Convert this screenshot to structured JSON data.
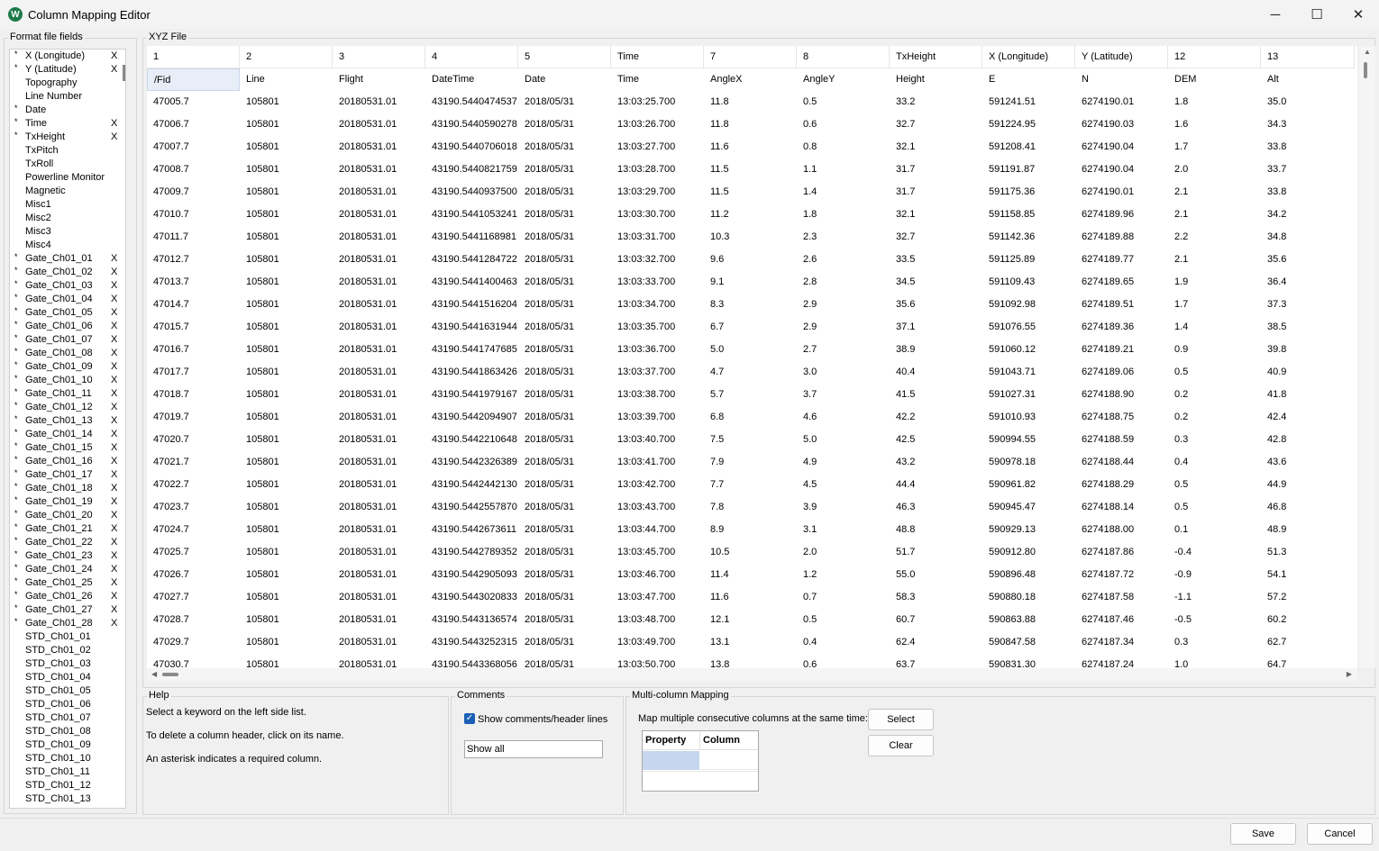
{
  "window": {
    "title": "Column Mapping Editor",
    "minimize": "─",
    "maximize": "☐",
    "close": "✕"
  },
  "fields_panel": {
    "label": "Format file fields",
    "items": [
      {
        "name": "X (Longitude)",
        "required": true,
        "mapped": true
      },
      {
        "name": "Y (Latitude)",
        "required": true,
        "mapped": true
      },
      {
        "name": "Topography",
        "required": false,
        "mapped": false
      },
      {
        "name": "Line Number",
        "required": false,
        "mapped": false
      },
      {
        "name": "Date",
        "required": true,
        "mapped": false
      },
      {
        "name": "Time",
        "required": true,
        "mapped": true
      },
      {
        "name": "TxHeight",
        "required": true,
        "mapped": true
      },
      {
        "name": "TxPitch",
        "required": false,
        "mapped": false
      },
      {
        "name": "TxRoll",
        "required": false,
        "mapped": false
      },
      {
        "name": "Powerline Monitor",
        "required": false,
        "mapped": false
      },
      {
        "name": "Magnetic",
        "required": false,
        "mapped": false
      },
      {
        "name": "Misc1",
        "required": false,
        "mapped": false
      },
      {
        "name": "Misc2",
        "required": false,
        "mapped": false
      },
      {
        "name": "Misc3",
        "required": false,
        "mapped": false
      },
      {
        "name": "Misc4",
        "required": false,
        "mapped": false
      },
      {
        "name": "Gate_Ch01_01",
        "required": true,
        "mapped": true
      },
      {
        "name": "Gate_Ch01_02",
        "required": true,
        "mapped": true
      },
      {
        "name": "Gate_Ch01_03",
        "required": true,
        "mapped": true
      },
      {
        "name": "Gate_Ch01_04",
        "required": true,
        "mapped": true
      },
      {
        "name": "Gate_Ch01_05",
        "required": true,
        "mapped": true
      },
      {
        "name": "Gate_Ch01_06",
        "required": true,
        "mapped": true
      },
      {
        "name": "Gate_Ch01_07",
        "required": true,
        "mapped": true
      },
      {
        "name": "Gate_Ch01_08",
        "required": true,
        "mapped": true
      },
      {
        "name": "Gate_Ch01_09",
        "required": true,
        "mapped": true
      },
      {
        "name": "Gate_Ch01_10",
        "required": true,
        "mapped": true
      },
      {
        "name": "Gate_Ch01_11",
        "required": true,
        "mapped": true
      },
      {
        "name": "Gate_Ch01_12",
        "required": true,
        "mapped": true
      },
      {
        "name": "Gate_Ch01_13",
        "required": true,
        "mapped": true
      },
      {
        "name": "Gate_Ch01_14",
        "required": true,
        "mapped": true
      },
      {
        "name": "Gate_Ch01_15",
        "required": true,
        "mapped": true
      },
      {
        "name": "Gate_Ch01_16",
        "required": true,
        "mapped": true
      },
      {
        "name": "Gate_Ch01_17",
        "required": true,
        "mapped": true
      },
      {
        "name": "Gate_Ch01_18",
        "required": true,
        "mapped": true
      },
      {
        "name": "Gate_Ch01_19",
        "required": true,
        "mapped": true
      },
      {
        "name": "Gate_Ch01_20",
        "required": true,
        "mapped": true
      },
      {
        "name": "Gate_Ch01_21",
        "required": true,
        "mapped": true
      },
      {
        "name": "Gate_Ch01_22",
        "required": true,
        "mapped": true
      },
      {
        "name": "Gate_Ch01_23",
        "required": true,
        "mapped": true
      },
      {
        "name": "Gate_Ch01_24",
        "required": true,
        "mapped": true
      },
      {
        "name": "Gate_Ch01_25",
        "required": true,
        "mapped": true
      },
      {
        "name": "Gate_Ch01_26",
        "required": true,
        "mapped": true
      },
      {
        "name": "Gate_Ch01_27",
        "required": true,
        "mapped": true
      },
      {
        "name": "Gate_Ch01_28",
        "required": true,
        "mapped": true
      },
      {
        "name": "STD_Ch01_01",
        "required": false,
        "mapped": false
      },
      {
        "name": "STD_Ch01_02",
        "required": false,
        "mapped": false
      },
      {
        "name": "STD_Ch01_03",
        "required": false,
        "mapped": false
      },
      {
        "name": "STD_Ch01_04",
        "required": false,
        "mapped": false
      },
      {
        "name": "STD_Ch01_05",
        "required": false,
        "mapped": false
      },
      {
        "name": "STD_Ch01_06",
        "required": false,
        "mapped": false
      },
      {
        "name": "STD_Ch01_07",
        "required": false,
        "mapped": false
      },
      {
        "name": "STD_Ch01_08",
        "required": false,
        "mapped": false
      },
      {
        "name": "STD_Ch01_09",
        "required": false,
        "mapped": false
      },
      {
        "name": "STD_Ch01_10",
        "required": false,
        "mapped": false
      },
      {
        "name": "STD_Ch01_11",
        "required": false,
        "mapped": false
      },
      {
        "name": "STD_Ch01_12",
        "required": false,
        "mapped": false
      },
      {
        "name": "STD_Ch01_13",
        "required": false,
        "mapped": false
      }
    ],
    "asterisk": "*",
    "mapped_mark": "X"
  },
  "grid": {
    "label": "XYZ File",
    "mapping_headers": [
      "1",
      "2",
      "3",
      "4",
      "5",
      "Time",
      "7",
      "8",
      "TxHeight",
      "X (Longitude)",
      "Y (Latitude)",
      "12",
      "13"
    ],
    "file_headers": [
      "/Fid",
      "Line",
      "Flight",
      "DateTime",
      "Date",
      "Time",
      "AngleX",
      "AngleY",
      "Height",
      "E",
      "N",
      "DEM",
      "Alt"
    ],
    "rows": [
      [
        "47005.7",
        "105801",
        "20180531.01",
        "43190.5440474537",
        "2018/05/31",
        "13:03:25.700",
        "11.8",
        "0.5",
        "33.2",
        "591241.51",
        "6274190.01",
        "1.8",
        "35.0"
      ],
      [
        "47006.7",
        "105801",
        "20180531.01",
        "43190.5440590278",
        "2018/05/31",
        "13:03:26.700",
        "11.8",
        "0.6",
        "32.7",
        "591224.95",
        "6274190.03",
        "1.6",
        "34.3"
      ],
      [
        "47007.7",
        "105801",
        "20180531.01",
        "43190.5440706018",
        "2018/05/31",
        "13:03:27.700",
        "11.6",
        "0.8",
        "32.1",
        "591208.41",
        "6274190.04",
        "1.7",
        "33.8"
      ],
      [
        "47008.7",
        "105801",
        "20180531.01",
        "43190.5440821759",
        "2018/05/31",
        "13:03:28.700",
        "11.5",
        "1.1",
        "31.7",
        "591191.87",
        "6274190.04",
        "2.0",
        "33.7"
      ],
      [
        "47009.7",
        "105801",
        "20180531.01",
        "43190.5440937500",
        "2018/05/31",
        "13:03:29.700",
        "11.5",
        "1.4",
        "31.7",
        "591175.36",
        "6274190.01",
        "2.1",
        "33.8"
      ],
      [
        "47010.7",
        "105801",
        "20180531.01",
        "43190.5441053241",
        "2018/05/31",
        "13:03:30.700",
        "11.2",
        "1.8",
        "32.1",
        "591158.85",
        "6274189.96",
        "2.1",
        "34.2"
      ],
      [
        "47011.7",
        "105801",
        "20180531.01",
        "43190.5441168981",
        "2018/05/31",
        "13:03:31.700",
        "10.3",
        "2.3",
        "32.7",
        "591142.36",
        "6274189.88",
        "2.2",
        "34.8"
      ],
      [
        "47012.7",
        "105801",
        "20180531.01",
        "43190.5441284722",
        "2018/05/31",
        "13:03:32.700",
        "9.6",
        "2.6",
        "33.5",
        "591125.89",
        "6274189.77",
        "2.1",
        "35.6"
      ],
      [
        "47013.7",
        "105801",
        "20180531.01",
        "43190.5441400463",
        "2018/05/31",
        "13:03:33.700",
        "9.1",
        "2.8",
        "34.5",
        "591109.43",
        "6274189.65",
        "1.9",
        "36.4"
      ],
      [
        "47014.7",
        "105801",
        "20180531.01",
        "43190.5441516204",
        "2018/05/31",
        "13:03:34.700",
        "8.3",
        "2.9",
        "35.6",
        "591092.98",
        "6274189.51",
        "1.7",
        "37.3"
      ],
      [
        "47015.7",
        "105801",
        "20180531.01",
        "43190.5441631944",
        "2018/05/31",
        "13:03:35.700",
        "6.7",
        "2.9",
        "37.1",
        "591076.55",
        "6274189.36",
        "1.4",
        "38.5"
      ],
      [
        "47016.7",
        "105801",
        "20180531.01",
        "43190.5441747685",
        "2018/05/31",
        "13:03:36.700",
        "5.0",
        "2.7",
        "38.9",
        "591060.12",
        "6274189.21",
        "0.9",
        "39.8"
      ],
      [
        "47017.7",
        "105801",
        "20180531.01",
        "43190.5441863426",
        "2018/05/31",
        "13:03:37.700",
        "4.7",
        "3.0",
        "40.4",
        "591043.71",
        "6274189.06",
        "0.5",
        "40.9"
      ],
      [
        "47018.7",
        "105801",
        "20180531.01",
        "43190.5441979167",
        "2018/05/31",
        "13:03:38.700",
        "5.7",
        "3.7",
        "41.5",
        "591027.31",
        "6274188.90",
        "0.2",
        "41.8"
      ],
      [
        "47019.7",
        "105801",
        "20180531.01",
        "43190.5442094907",
        "2018/05/31",
        "13:03:39.700",
        "6.8",
        "4.6",
        "42.2",
        "591010.93",
        "6274188.75",
        "0.2",
        "42.4"
      ],
      [
        "47020.7",
        "105801",
        "20180531.01",
        "43190.5442210648",
        "2018/05/31",
        "13:03:40.700",
        "7.5",
        "5.0",
        "42.5",
        "590994.55",
        "6274188.59",
        "0.3",
        "42.8"
      ],
      [
        "47021.7",
        "105801",
        "20180531.01",
        "43190.5442326389",
        "2018/05/31",
        "13:03:41.700",
        "7.9",
        "4.9",
        "43.2",
        "590978.18",
        "6274188.44",
        "0.4",
        "43.6"
      ],
      [
        "47022.7",
        "105801",
        "20180531.01",
        "43190.5442442130",
        "2018/05/31",
        "13:03:42.700",
        "7.7",
        "4.5",
        "44.4",
        "590961.82",
        "6274188.29",
        "0.5",
        "44.9"
      ],
      [
        "47023.7",
        "105801",
        "20180531.01",
        "43190.5442557870",
        "2018/05/31",
        "13:03:43.700",
        "7.8",
        "3.9",
        "46.3",
        "590945.47",
        "6274188.14",
        "0.5",
        "46.8"
      ],
      [
        "47024.7",
        "105801",
        "20180531.01",
        "43190.5442673611",
        "2018/05/31",
        "13:03:44.700",
        "8.9",
        "3.1",
        "48.8",
        "590929.13",
        "6274188.00",
        "0.1",
        "48.9"
      ],
      [
        "47025.7",
        "105801",
        "20180531.01",
        "43190.5442789352",
        "2018/05/31",
        "13:03:45.700",
        "10.5",
        "2.0",
        "51.7",
        "590912.80",
        "6274187.86",
        "-0.4",
        "51.3"
      ],
      [
        "47026.7",
        "105801",
        "20180531.01",
        "43190.5442905093",
        "2018/05/31",
        "13:03:46.700",
        "11.4",
        "1.2",
        "55.0",
        "590896.48",
        "6274187.72",
        "-0.9",
        "54.1"
      ],
      [
        "47027.7",
        "105801",
        "20180531.01",
        "43190.5443020833",
        "2018/05/31",
        "13:03:47.700",
        "11.6",
        "0.7",
        "58.3",
        "590880.18",
        "6274187.58",
        "-1.1",
        "57.2"
      ],
      [
        "47028.7",
        "105801",
        "20180531.01",
        "43190.5443136574",
        "2018/05/31",
        "13:03:48.700",
        "12.1",
        "0.5",
        "60.7",
        "590863.88",
        "6274187.46",
        "-0.5",
        "60.2"
      ],
      [
        "47029.7",
        "105801",
        "20180531.01",
        "43190.5443252315",
        "2018/05/31",
        "13:03:49.700",
        "13.1",
        "0.4",
        "62.4",
        "590847.58",
        "6274187.34",
        "0.3",
        "62.7"
      ],
      [
        "47030.7",
        "105801",
        "20180531.01",
        "43190.5443368056",
        "2018/05/31",
        "13:03:50.700",
        "13.8",
        "0.6",
        "63.7",
        "590831.30",
        "6274187.24",
        "1.0",
        "64.7"
      ]
    ]
  },
  "help": {
    "label": "Help",
    "lines": [
      "Select a keyword on the left side list.",
      "To delete a column header, click on its name.",
      "An asterisk indicates a required column."
    ]
  },
  "comments": {
    "label": "Comments",
    "checkbox_label": "Show comments/header lines",
    "checkbox_checked": true,
    "check_mark": "✓",
    "combo_value": "Show all",
    "combo_chevron": "⌵"
  },
  "multi": {
    "label": "Multi-column Mapping",
    "description": "Map multiple consecutive columns at the same time:",
    "select_label": "Select",
    "clear_label": "Clear",
    "col_property": "Property",
    "col_column": "Column"
  },
  "footer": {
    "save_label": "Save",
    "cancel_label": "Cancel"
  },
  "colors": {
    "accent": "#1a5fb4",
    "selection": "#c7d6ef",
    "app_icon": "#1e7a4a"
  }
}
